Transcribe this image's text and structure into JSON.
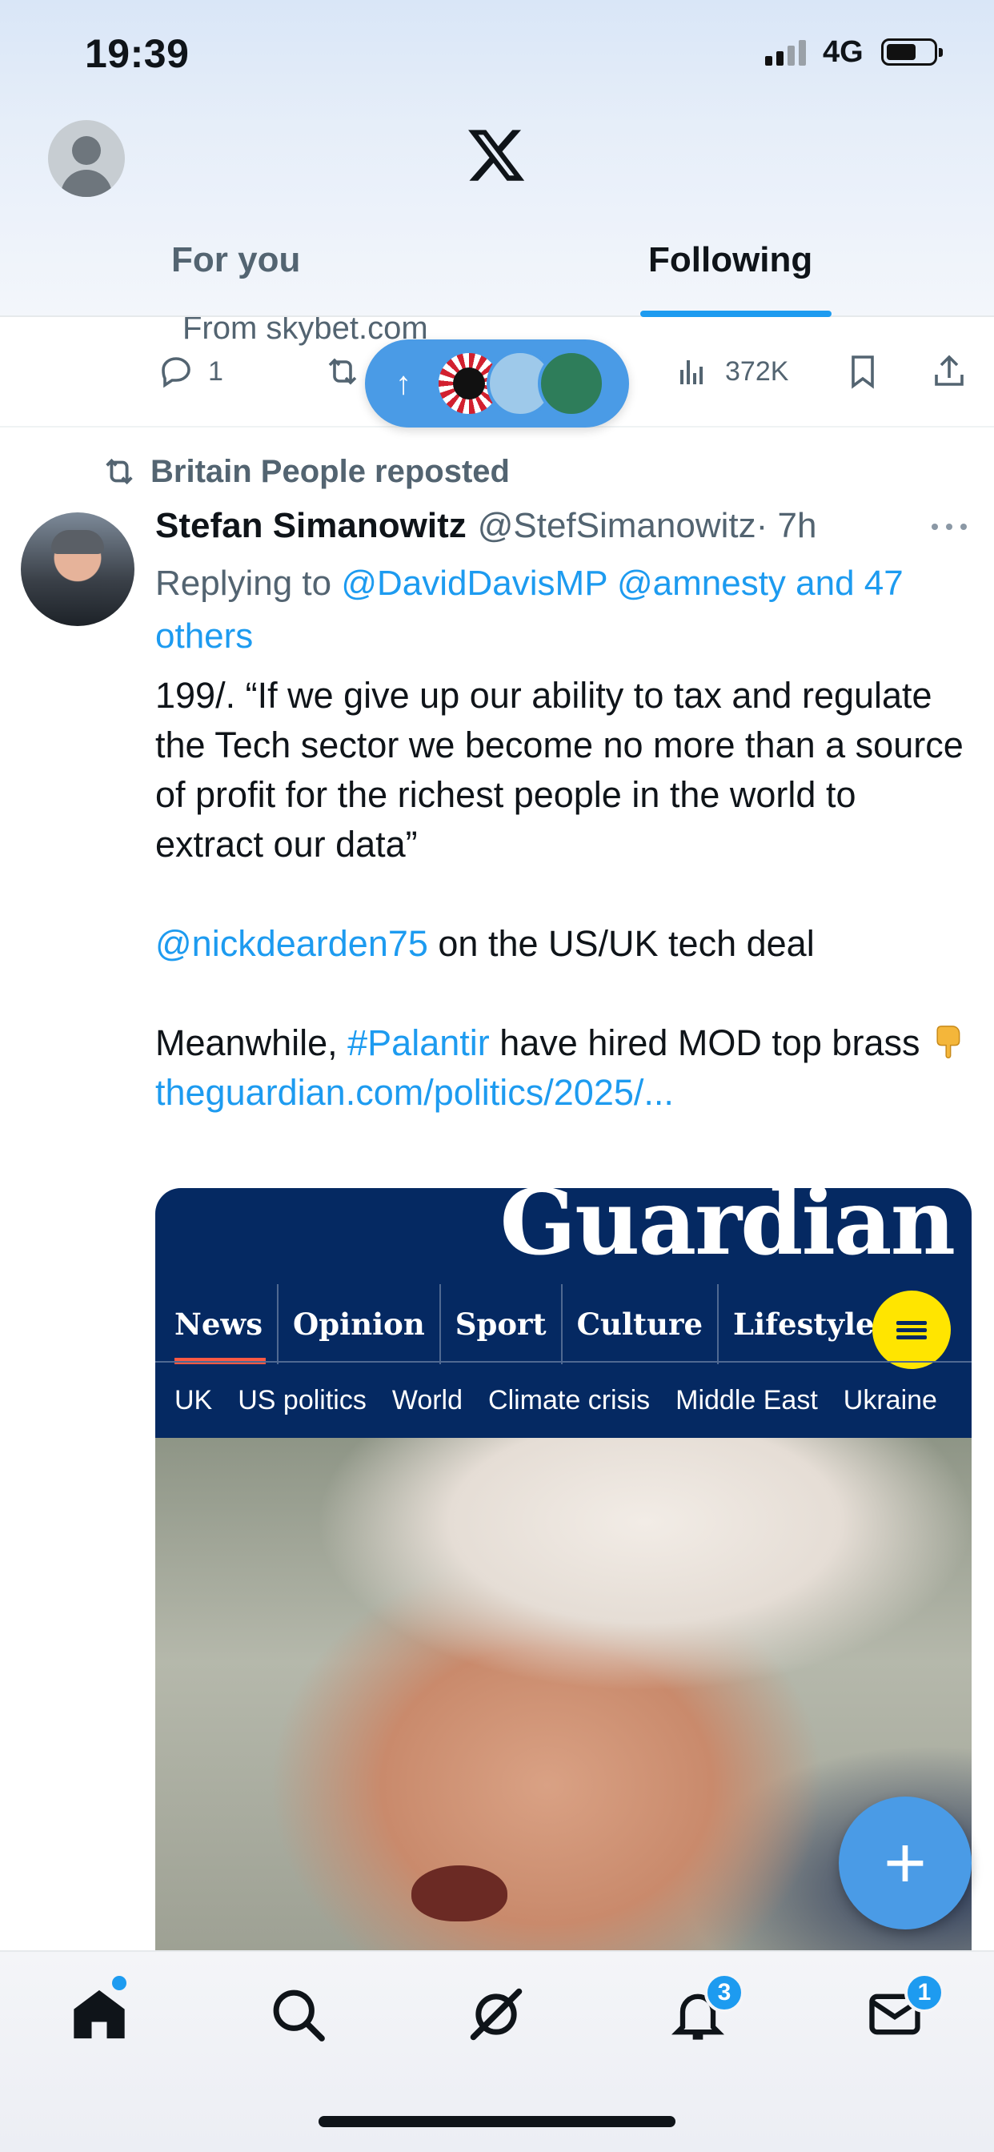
{
  "status_bar": {
    "time": "19:39",
    "network": "4G"
  },
  "header": {
    "logo": "x-logo",
    "tabs": [
      {
        "label": "For you",
        "active": false
      },
      {
        "label": "Following",
        "active": true
      }
    ]
  },
  "previous_post": {
    "source_partial": "From skybet.com",
    "replies": "1",
    "views": "372K",
    "icons": [
      "reply-icon",
      "repost-icon",
      "views-icon",
      "bookmark-icon",
      "share-icon"
    ]
  },
  "new_posts_pill": {
    "icon": "arrow-up-icon"
  },
  "post": {
    "repost_label": "Britain People reposted",
    "author_name": "Stefan Simanowitz",
    "author_handle": "@StefSimanowitz",
    "time": "· 7h",
    "replying_prefix": "Replying to ",
    "replying_mentions": "@DavidDavisMP @amnesty and 47 others",
    "body": {
      "line1": "199/. “If we give up our ability to tax and regulate the Tech sector we become no more than a source of profit for the richest people in the world to extract our data”",
      "mention": "@nickdearden75",
      "line2_rest": " on the US/UK tech deal",
      "line3_prefix": "Meanwhile, ",
      "hashtag": "#Palantir",
      "line3_rest": " have hired MOD top brass ",
      "emoji": "pointing-down-emoji",
      "url": "theguardian.com/politics/2025/..."
    },
    "card": {
      "masthead": "Guardian",
      "pillars": [
        "News",
        "Opinion",
        "Sport",
        "Culture",
        "Lifestyle"
      ],
      "subnav": [
        "UK",
        "US politics",
        "World",
        "Climate crisis",
        "Middle East",
        "Ukraine"
      ]
    }
  },
  "compose_button": {
    "label": "+"
  },
  "bottom_nav": {
    "items": [
      "home-icon",
      "search-icon",
      "grok-icon",
      "notifications-icon",
      "messages-icon"
    ],
    "notifications_badge": "3",
    "messages_badge": "1"
  },
  "colors": {
    "accent": "#1d9bf0",
    "guardian_blue": "#052962",
    "guardian_red": "#ff5943",
    "guardian_yellow": "#ffe500"
  }
}
